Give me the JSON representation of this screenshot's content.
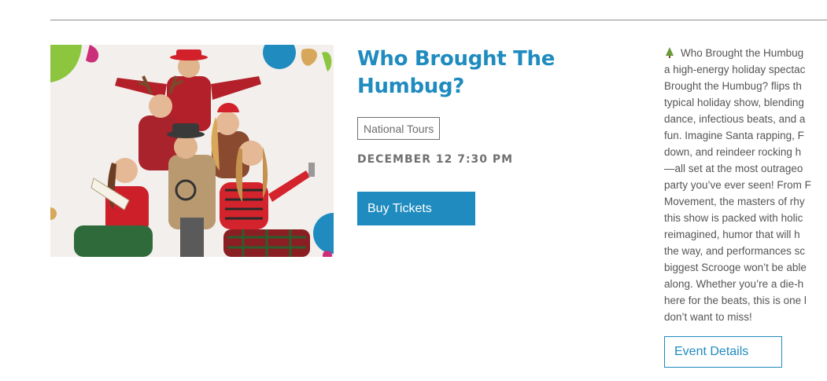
{
  "event": {
    "title_line1": "Who Brought The",
    "title_line2": "Humbug?",
    "category": "National Tours",
    "date": "DECEMBER 12 7:30 PM",
    "buy_label": "Buy Tickets",
    "details_label": "Event Details",
    "image_alt": "Cast of Who Brought The Humbug in festive holiday outfits",
    "description_icon": "christmas-tree-icon",
    "description_lines": [
      "Who Brought the Humbug",
      "a high-energy holiday spectac",
      "Brought the Humbug? flips th",
      "typical holiday show, blending",
      "dance, infectious beats, and a",
      "fun. Imagine Santa rapping, F",
      "down, and reindeer rocking h",
      "—all set at the most outrageo",
      "party you’ve ever seen! From F",
      "Movement, the masters of rhy",
      "this show is packed with holic",
      "reimagined, humor that will h",
      "the way, and performances sc",
      "biggest Scrooge won’t be able",
      "along. Whether you’re a die-h",
      "here for the beats, this is one l",
      "don’t want to miss!"
    ]
  },
  "colors": {
    "brand_blue": "#1f8bbf",
    "text_gray": "#555555",
    "meta_gray": "#707070"
  }
}
